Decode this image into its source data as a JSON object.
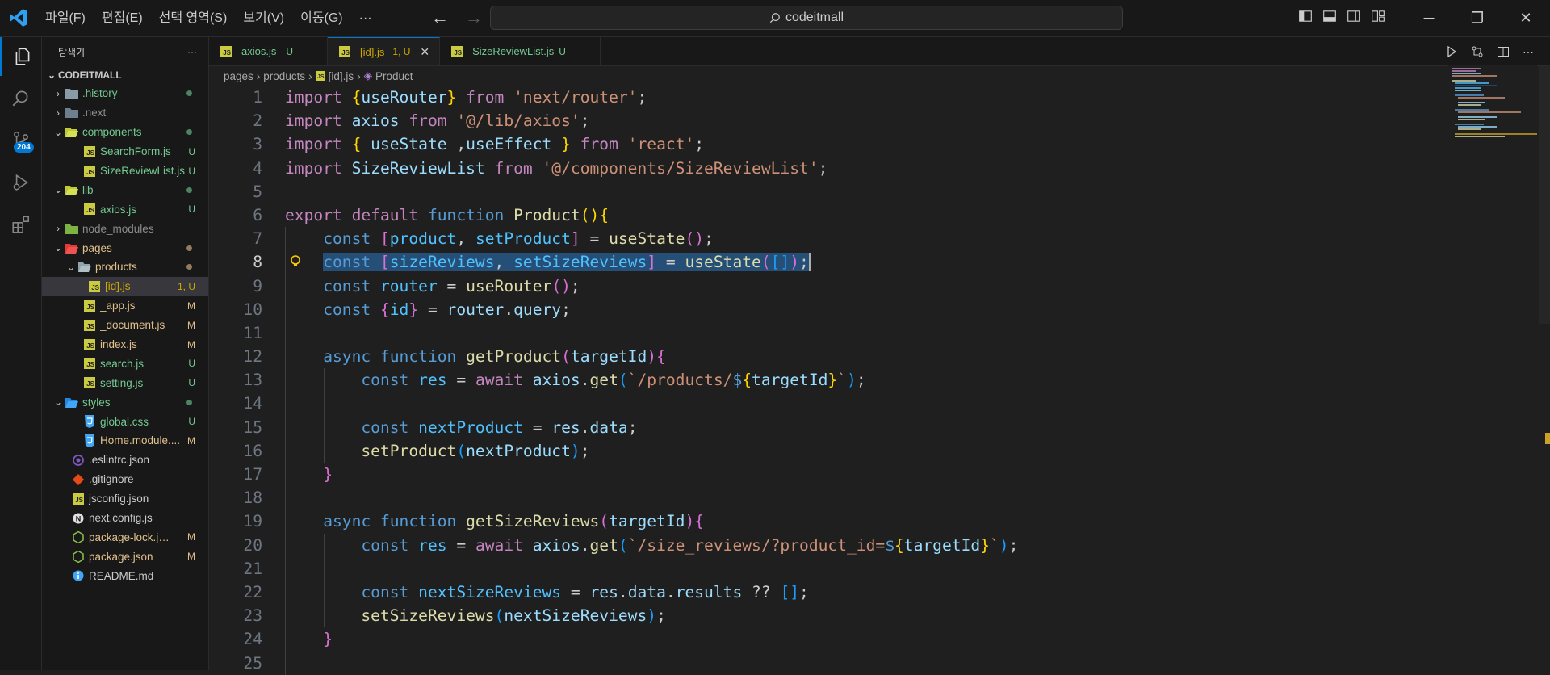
{
  "menu": [
    "파일(F)",
    "편집(E)",
    "선택 영역(S)",
    "보기(V)",
    "이동(G)",
    "···"
  ],
  "search": {
    "text": "codeitmall"
  },
  "sidebar": {
    "title": "탐색기",
    "more": "···",
    "root": "CODEITMALL",
    "items": [
      {
        "name": ".history",
        "status": ""
      },
      {
        "name": ".next",
        "status": ""
      },
      {
        "name": "components",
        "status": ""
      },
      {
        "name": "SearchForm.js",
        "status": "U"
      },
      {
        "name": "SizeReviewList.js",
        "status": "U"
      },
      {
        "name": "lib",
        "status": ""
      },
      {
        "name": "axios.js",
        "status": "U"
      },
      {
        "name": "node_modules",
        "status": ""
      },
      {
        "name": "pages",
        "status": ""
      },
      {
        "name": "products",
        "status": ""
      },
      {
        "name": "[id].js",
        "status": "1, U"
      },
      {
        "name": "_app.js",
        "status": "M"
      },
      {
        "name": "_document.js",
        "status": "M"
      },
      {
        "name": "index.js",
        "status": "M"
      },
      {
        "name": "search.js",
        "status": "U"
      },
      {
        "name": "setting.js",
        "status": "U"
      },
      {
        "name": "styles",
        "status": ""
      },
      {
        "name": "global.css",
        "status": "U"
      },
      {
        "name": "Home.module....",
        "status": "M"
      },
      {
        "name": ".eslintrc.json",
        "status": ""
      },
      {
        "name": ".gitignore",
        "status": ""
      },
      {
        "name": "jsconfig.json",
        "status": ""
      },
      {
        "name": "next.config.js",
        "status": ""
      },
      {
        "name": "package-lock.js...",
        "status": "M"
      },
      {
        "name": "package.json",
        "status": "M"
      },
      {
        "name": "README.md",
        "status": ""
      }
    ]
  },
  "activity": {
    "badge": "204"
  },
  "tabs": [
    {
      "label": "axios.js",
      "status": "U"
    },
    {
      "label": "[id].js",
      "status": "1, U"
    },
    {
      "label": "SizeReviewList.js",
      "status": "U"
    }
  ],
  "breadcrumb": {
    "a": "pages",
    "b": "products",
    "c": "[id].js",
    "d": "Product"
  },
  "code": {
    "l1a": "import",
    "l1b": "useRouter",
    "l1c": "from",
    "l1d": "'next/router'",
    "l2a": "import",
    "l2b": "axios",
    "l2c": "from",
    "l2d": "'@/lib/axios'",
    "l3a": "import",
    "l3b": "useState",
    "l3c": "useEffect",
    "l3d": "from",
    "l3e": "'react'",
    "l4a": "import",
    "l4b": "SizeReviewList",
    "l4c": "from",
    "l4d": "'@/components/SizeReviewList'",
    "l6a": "export",
    "l6b": "default",
    "l6c": "function",
    "l6d": "Product",
    "l7a": "const",
    "l7b": "product",
    "l7c": "setProduct",
    "l7d": "useState",
    "l8a": "const",
    "l8b": "sizeReviews",
    "l8c": "setSizeReviews",
    "l8d": "useState",
    "l9a": "const",
    "l9b": "router",
    "l9c": "useRouter",
    "l10a": "const",
    "l10b": "id",
    "l10c": "router",
    "l10d": "query",
    "l12a": "async",
    "l12b": "function",
    "l12c": "getProduct",
    "l12d": "targetId",
    "l13a": "const",
    "l13b": "res",
    "l13c": "await",
    "l13d": "axios",
    "l13e": "get",
    "l13f": "`/products/",
    "l13g": "targetId",
    "l15a": "const",
    "l15b": "nextProduct",
    "l15c": "res",
    "l15d": "data",
    "l16a": "setProduct",
    "l16b": "nextProduct",
    "l19a": "async",
    "l19b": "function",
    "l19c": "getSizeReviews",
    "l19d": "targetId",
    "l20a": "const",
    "l20b": "res",
    "l20c": "await",
    "l20d": "axios",
    "l20e": "get",
    "l20f": "`/size_reviews/?product_id=",
    "l20g": "targetId",
    "l22a": "const",
    "l22b": "nextSizeReviews",
    "l22c": "res",
    "l22d": "data",
    "l22e": "results",
    "l23a": "setSizeReviews",
    "l23b": "nextSizeReviews"
  },
  "line_numbers": [
    "1",
    "2",
    "3",
    "4",
    "5",
    "6",
    "7",
    "8",
    "9",
    "10",
    "11",
    "12",
    "13",
    "14",
    "15",
    "16",
    "17",
    "18",
    "19",
    "20",
    "21",
    "22",
    "23",
    "24",
    "25"
  ]
}
